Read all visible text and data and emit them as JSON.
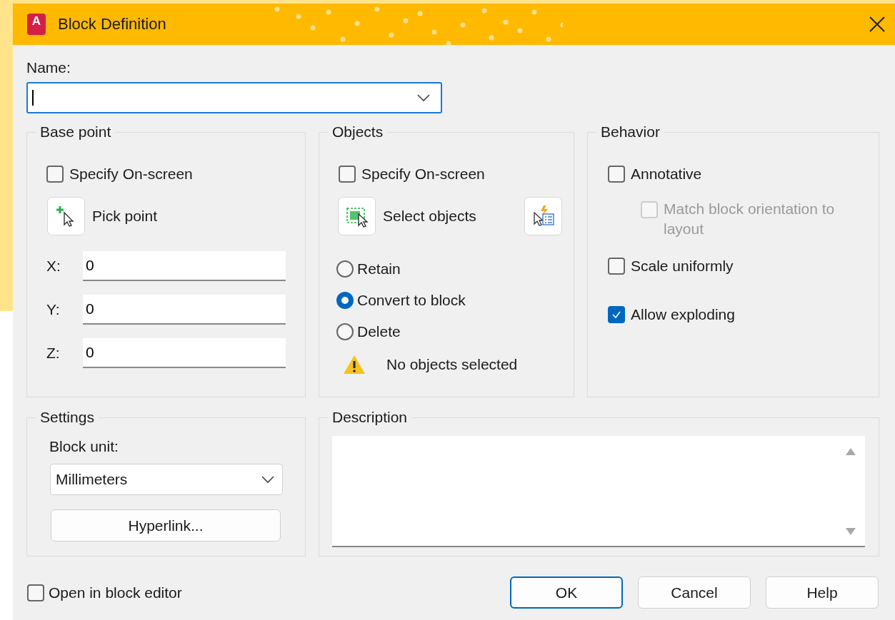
{
  "window": {
    "title": "Block Definition",
    "app_icon_letter": "A"
  },
  "name": {
    "label": "Name:"
  },
  "base_point": {
    "title": "Base point",
    "specify_on_screen": {
      "label": "Specify On-screen",
      "checked": false
    },
    "pick_button": "Pick point",
    "coordinates": [
      {
        "label": "X:",
        "value": "0"
      },
      {
        "label": "Y:",
        "value": "0"
      },
      {
        "label": "Z:",
        "value": "0"
      }
    ]
  },
  "objects": {
    "title": "Objects",
    "specify_on_screen": {
      "label": "Specify On-screen",
      "checked": false
    },
    "select_button": "Select objects",
    "options": [
      {
        "label": "Retain",
        "selected": false
      },
      {
        "label": "Convert to block",
        "selected": true
      },
      {
        "label": "Delete",
        "selected": false
      }
    ],
    "warning": "No objects selected"
  },
  "behavior": {
    "title": "Behavior",
    "options": [
      {
        "label": "Annotative",
        "checked": false,
        "children": [
          {
            "label": "Match block orientation to layout",
            "checked": false,
            "disabled": true
          }
        ]
      },
      {
        "label": "Scale uniformly",
        "checked": false
      },
      {
        "label": "Allow exploding",
        "checked": true
      }
    ]
  },
  "settings": {
    "title": "Settings",
    "unit_label": "Block unit:",
    "unit": "Millimeters",
    "hyperlink_button": "Hyperlink..."
  },
  "description": {
    "title": "Description"
  },
  "open_in_block_editor": {
    "label": "Open in block editor",
    "checked": false
  },
  "buttons": [
    {
      "label": "OK",
      "default": true
    },
    {
      "label": "Cancel",
      "default": false
    },
    {
      "label": "Help",
      "default": false
    }
  ]
}
